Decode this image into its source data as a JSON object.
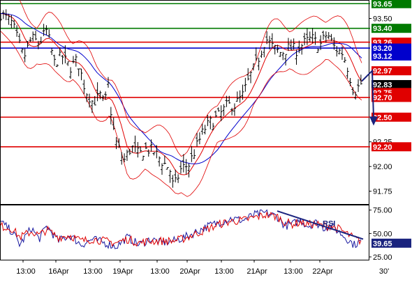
{
  "chart_data": [
    {
      "type": "candlestick",
      "panel": "price",
      "ylim": [
        91.62,
        93.68
      ],
      "y_ticks": [
        {
          "v": 93.5,
          "label": "93.50"
        },
        {
          "v": 92.25,
          "label": "92.25"
        },
        {
          "v": 92.0,
          "label": "92.00"
        },
        {
          "v": 91.75,
          "label": "91.75"
        }
      ],
      "x_ticks": [
        "13:00",
        "16Apr",
        "13:00",
        "19Apr",
        "13:00",
        "20Apr",
        "13:00",
        "21Apr",
        "13:00",
        "22Apr",
        "30'"
      ],
      "horizontal_levels": [
        {
          "value": 93.65,
          "label": "93.65",
          "color": "#007a00"
        },
        {
          "value": 93.4,
          "label": "93.40",
          "color": "#007a00"
        },
        {
          "value": 93.26,
          "label": "93.26",
          "color": "#e00000"
        },
        {
          "value": 93.2,
          "label": "93.20",
          "color": "#0000cc"
        },
        {
          "value": 93.12,
          "label": "93.12",
          "color": "#0000cc",
          "line": false
        },
        {
          "value": 92.97,
          "label": "92.97",
          "color": "#e00000",
          "line": false
        },
        {
          "value": 92.83,
          "label": "92.83",
          "color": "#000000",
          "line": false,
          "current": true
        },
        {
          "value": 92.75,
          "label": "92.75",
          "color": "#e00000",
          "line": false
        },
        {
          "value": 92.7,
          "label": "92.70",
          "color": "#e00000"
        },
        {
          "value": 92.5,
          "label": "92.50",
          "color": "#e00000"
        },
        {
          "value": 92.2,
          "label": "92.20",
          "color": "#e00000"
        }
      ],
      "price_path": [
        [
          0,
          93.55
        ],
        [
          3,
          93.45
        ],
        [
          6,
          93.1
        ],
        [
          8,
          93.3
        ],
        [
          10,
          93.25
        ],
        [
          12,
          93.38
        ],
        [
          14,
          93.05
        ],
        [
          16,
          93.12
        ],
        [
          18,
          93.0
        ],
        [
          20,
          93.08
        ],
        [
          22,
          92.78
        ],
        [
          24,
          92.65
        ],
        [
          26,
          92.72
        ],
        [
          27,
          92.62
        ],
        [
          28,
          92.82
        ],
        [
          29,
          92.45
        ],
        [
          30,
          92.25
        ],
        [
          32,
          92.05
        ],
        [
          34,
          92.2
        ],
        [
          36,
          92.12
        ],
        [
          38,
          92.18
        ],
        [
          40,
          92.15
        ],
        [
          42,
          92.05
        ],
        [
          44,
          91.98
        ],
        [
          45,
          91.78
        ],
        [
          47,
          91.98
        ],
        [
          49,
          92.02
        ],
        [
          51,
          92.2
        ],
        [
          53,
          92.38
        ],
        [
          55,
          92.46
        ],
        [
          57,
          92.52
        ],
        [
          59,
          92.62
        ],
        [
          61,
          92.62
        ],
        [
          63,
          92.72
        ],
        [
          65,
          92.92
        ],
        [
          67,
          93.08
        ],
        [
          69,
          93.3
        ],
        [
          71,
          93.2
        ],
        [
          73,
          93.15
        ],
        [
          75,
          93.2
        ],
        [
          77,
          93.18
        ],
        [
          79,
          93.25
        ],
        [
          81,
          93.3
        ],
        [
          83,
          93.22
        ],
        [
          85,
          93.35
        ],
        [
          87,
          93.2
        ],
        [
          89,
          93.15
        ],
        [
          90,
          93.05
        ],
        [
          91,
          92.9
        ],
        [
          92,
          92.75
        ],
        [
          93,
          92.8
        ],
        [
          94,
          92.85
        ]
      ],
      "forecast_arrow": {
        "from": 92.97,
        "to": 92.45,
        "color": "#1a237e"
      }
    },
    {
      "type": "line",
      "panel": "indicator",
      "ylim": [
        22,
        80
      ],
      "y_ticks": [
        {
          "v": 75,
          "label": "75.00"
        },
        {
          "v": 50,
          "label": "50.00"
        },
        {
          "v": 25,
          "label": "25.00"
        }
      ],
      "current_value": {
        "value": 39.65,
        "label": "39.65"
      },
      "annotation": "RSI",
      "series": [
        {
          "color": "#1a1aa0",
          "points": [
            [
              0,
              62
            ],
            [
              3,
              52
            ],
            [
              5,
              38
            ],
            [
              8,
              56
            ],
            [
              10,
              44
            ],
            [
              12,
              58
            ],
            [
              15,
              42
            ],
            [
              18,
              48
            ],
            [
              21,
              38
            ],
            [
              24,
              44
            ],
            [
              27,
              40
            ],
            [
              30,
              36
            ],
            [
              33,
              46
            ],
            [
              36,
              38
            ],
            [
              39,
              44
            ],
            [
              42,
              40
            ],
            [
              45,
              42
            ],
            [
              48,
              46
            ],
            [
              51,
              52
            ],
            [
              54,
              58
            ],
            [
              57,
              62
            ],
            [
              60,
              66
            ],
            [
              63,
              64
            ],
            [
              66,
              70
            ],
            [
              69,
              72
            ],
            [
              72,
              68
            ],
            [
              74,
              58
            ],
            [
              76,
              60
            ],
            [
              78,
              64
            ],
            [
              80,
              58
            ],
            [
              82,
              62
            ],
            [
              84,
              56
            ],
            [
              86,
              58
            ],
            [
              88,
              52
            ],
            [
              90,
              45
            ],
            [
              92,
              38
            ],
            [
              93,
              40
            ],
            [
              94,
              42
            ]
          ]
        },
        {
          "color": "#e00000",
          "points": [
            [
              0,
              58
            ],
            [
              3,
              55
            ],
            [
              5,
              46
            ],
            [
              8,
              52
            ],
            [
              10,
              48
            ],
            [
              12,
              54
            ],
            [
              15,
              46
            ],
            [
              18,
              48
            ],
            [
              21,
              42
            ],
            [
              24,
              44
            ],
            [
              27,
              42
            ],
            [
              30,
              40
            ],
            [
              33,
              44
            ],
            [
              36,
              40
            ],
            [
              39,
              42
            ],
            [
              42,
              42
            ],
            [
              45,
              42
            ],
            [
              48,
              45
            ],
            [
              51,
              50
            ],
            [
              54,
              55
            ],
            [
              57,
              60
            ],
            [
              60,
              63
            ],
            [
              63,
              64
            ],
            [
              66,
              67
            ],
            [
              69,
              70
            ],
            [
              72,
              68
            ],
            [
              74,
              62
            ],
            [
              76,
              60
            ],
            [
              78,
              62
            ],
            [
              80,
              60
            ],
            [
              82,
              60
            ],
            [
              84,
              58
            ],
            [
              86,
              58
            ],
            [
              88,
              55
            ],
            [
              90,
              50
            ],
            [
              92,
              45
            ],
            [
              93,
              43
            ],
            [
              94,
              42
            ]
          ]
        }
      ],
      "trendline": {
        "from": [
          72,
          74
        ],
        "to": [
          94,
          44
        ],
        "color": "#1a237e"
      }
    }
  ]
}
